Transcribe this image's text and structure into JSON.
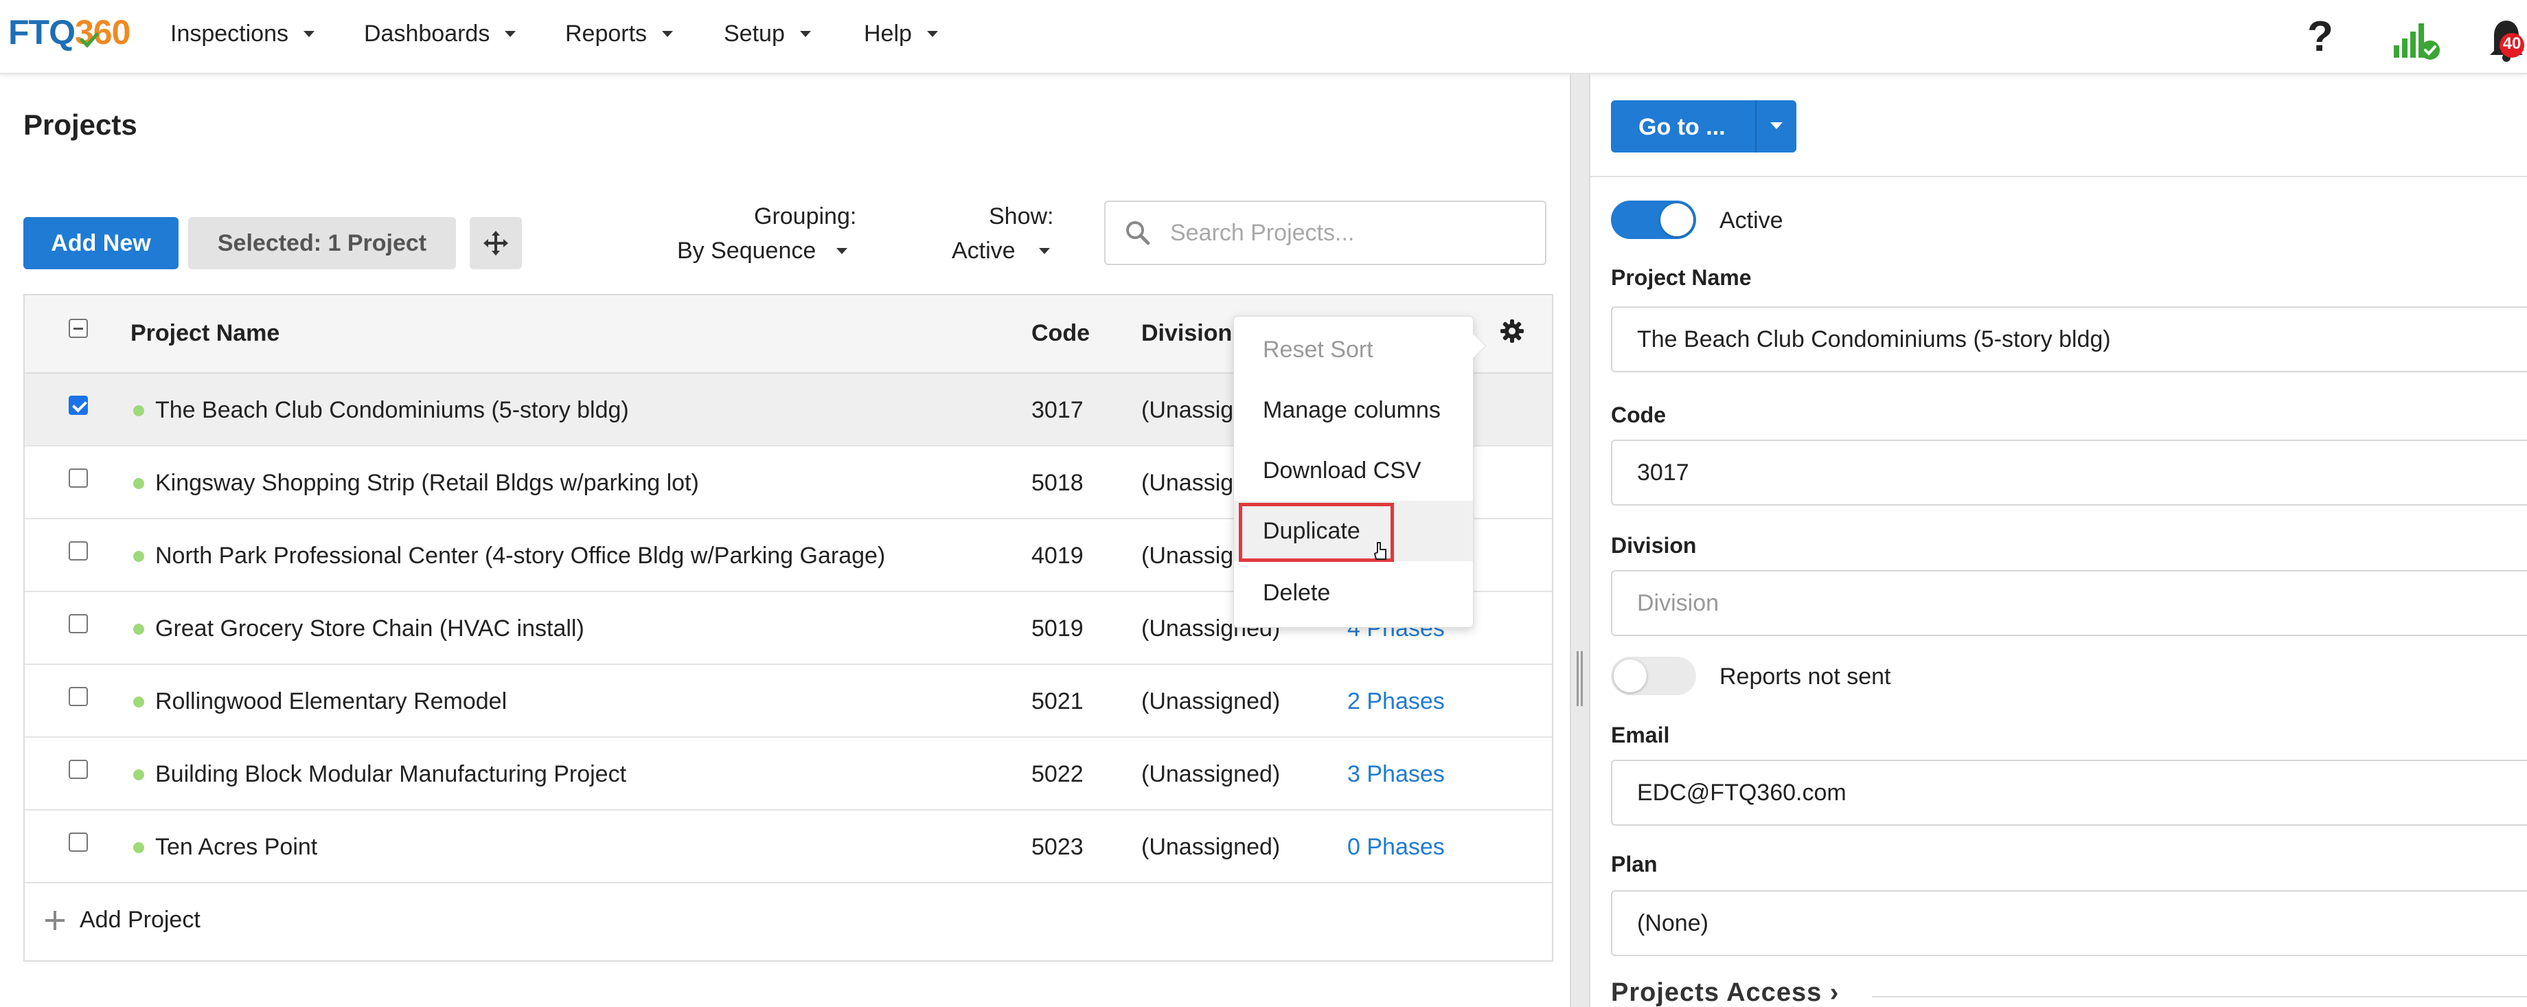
{
  "brand": {
    "logo_part1": "FTQ",
    "logo_part2": "360",
    "primary_color": "#1f7bd4",
    "accent_color": "#f08a24"
  },
  "nav": {
    "items": [
      {
        "label": "Inspections"
      },
      {
        "label": "Dashboards"
      },
      {
        "label": "Reports"
      },
      {
        "label": "Setup"
      },
      {
        "label": "Help"
      }
    ],
    "help_icon": "?",
    "signal_icon": "signal-connected-icon",
    "notifications": {
      "icon": "bell-icon",
      "count": "40"
    }
  },
  "projects_panel": {
    "title": "Projects",
    "add_new_label": "Add New",
    "selected_label": "Selected: 1 Project",
    "move_icon": "move-arrows-icon",
    "grouping": {
      "label": "Grouping:",
      "value": "By Sequence"
    },
    "show": {
      "label": "Show:",
      "value": "Active"
    },
    "search": {
      "placeholder": "Search Projects...",
      "value": ""
    },
    "columns": {
      "name": "Project Name",
      "code": "Code",
      "division": "Division",
      "settings_icon": "gear-icon"
    },
    "rows": [
      {
        "name": "The Beach Club Condominiums (5-story bldg)",
        "code": "3017",
        "division": "(Unassig",
        "phases": "",
        "checked": true,
        "status_color": "#9ed97a"
      },
      {
        "name": "Kingsway Shopping Strip (Retail Bldgs w/parking lot)",
        "code": "5018",
        "division": "(Unassig",
        "phases": "",
        "checked": false,
        "status_color": "#9ed97a"
      },
      {
        "name": "North Park Professional Center (4-story Office Bldg w/Parking Garage)",
        "code": "4019",
        "division": "(Unassig",
        "phases": "",
        "checked": false,
        "status_color": "#9ed97a"
      },
      {
        "name": "Great Grocery Store Chain (HVAC install)",
        "code": "5019",
        "division": "(Unassigned)",
        "phases": "4 Phases",
        "checked": false,
        "status_color": "#9ed97a"
      },
      {
        "name": "Rollingwood Elementary Remodel",
        "code": "5021",
        "division": "(Unassigned)",
        "phases": "2 Phases",
        "checked": false,
        "status_color": "#9ed97a"
      },
      {
        "name": "Building Block Modular Manufacturing Project",
        "code": "5022",
        "division": "(Unassigned)",
        "phases": "3 Phases",
        "checked": false,
        "status_color": "#9ed97a"
      },
      {
        "name": "Ten Acres Point",
        "code": "5023",
        "division": "(Unassigned)",
        "phases": "0 Phases",
        "checked": false,
        "status_color": "#9ed97a"
      }
    ],
    "add_project_label": "Add Project"
  },
  "context_menu": {
    "items": [
      {
        "label": "Reset Sort",
        "disabled": true
      },
      {
        "label": "Manage columns",
        "disabled": false
      },
      {
        "label": "Download CSV",
        "disabled": false
      },
      {
        "label": "Duplicate",
        "disabled": false,
        "highlighted": true
      },
      {
        "label": "Delete",
        "disabled": false
      }
    ],
    "highlight_color": "#e0393e"
  },
  "detail_panel": {
    "goto_label": "Go to ...",
    "active": {
      "label": "Active",
      "on": true
    },
    "project_name": {
      "label": "Project Name",
      "value": "The Beach Club Condominiums (5-story bldg)"
    },
    "code": {
      "label": "Code",
      "value": "3017"
    },
    "division": {
      "label": "Division",
      "placeholder": "Division"
    },
    "reports_not_sent": {
      "label": "Reports not sent",
      "on": false
    },
    "email": {
      "label": "Email",
      "value": "EDC@FTQ360.com"
    },
    "plan": {
      "label": "Plan",
      "value": "(None)"
    },
    "projects_access": {
      "label": "Projects Access ›"
    }
  }
}
